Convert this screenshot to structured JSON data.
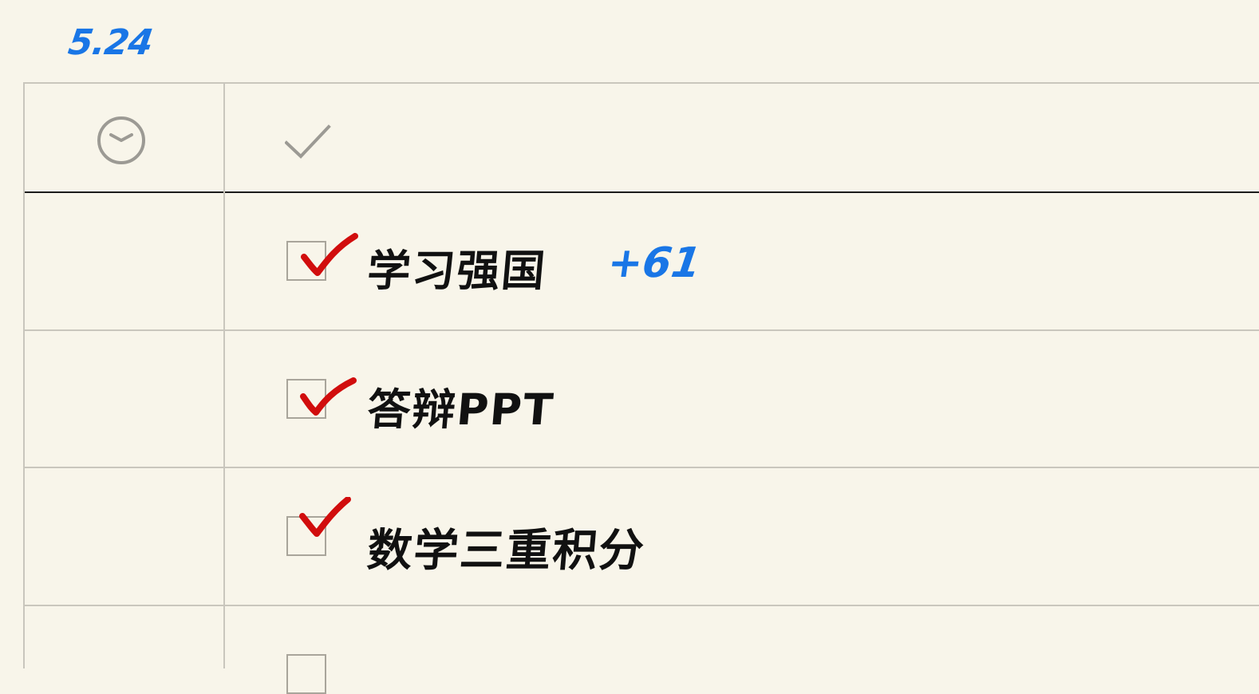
{
  "page": {
    "date": "5.24"
  },
  "header": {
    "time_icon": "clock-icon",
    "done_icon": "checkmark-icon"
  },
  "tasks": [
    {
      "label": "学习强国",
      "checked": true,
      "note": "+61"
    },
    {
      "label": "答辩PPT",
      "checked": true,
      "note": ""
    },
    {
      "label": "数学三重积分",
      "checked": true,
      "note": ""
    },
    {
      "label": "",
      "checked": false,
      "note": ""
    }
  ],
  "colors": {
    "paper": "#f8f5ea",
    "ink": "#111111",
    "grid": "#c9c6bd",
    "header_rule": "#1b1b1b",
    "blue_ink": "#1976e6",
    "red_check": "#d10d0d"
  }
}
